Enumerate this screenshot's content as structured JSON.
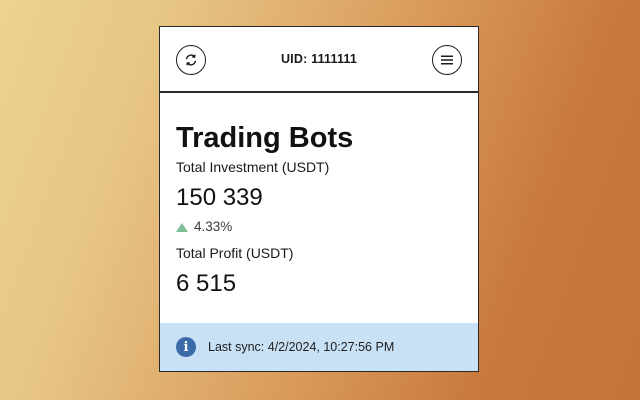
{
  "header": {
    "uid": "UID: 1111111",
    "refresh_icon": "refresh-icon",
    "menu_icon": "hamburger-menu-icon"
  },
  "main": {
    "title": "Trading Bots",
    "investment_label": "Total Investment (USDT)",
    "investment_value": "150 339",
    "change_percent": "4.33%",
    "change_direction": "up",
    "profit_label": "Total Profit (USDT)",
    "profit_value": "6 515"
  },
  "footer": {
    "icon": "info-icon",
    "sync_text": "Last sync: 4/2/2024, 10:27:56 PM"
  },
  "colors": {
    "accent_info": "#3b6aa8",
    "footer_bg": "#c8e1f5",
    "trend_up": "#7fbf98"
  }
}
